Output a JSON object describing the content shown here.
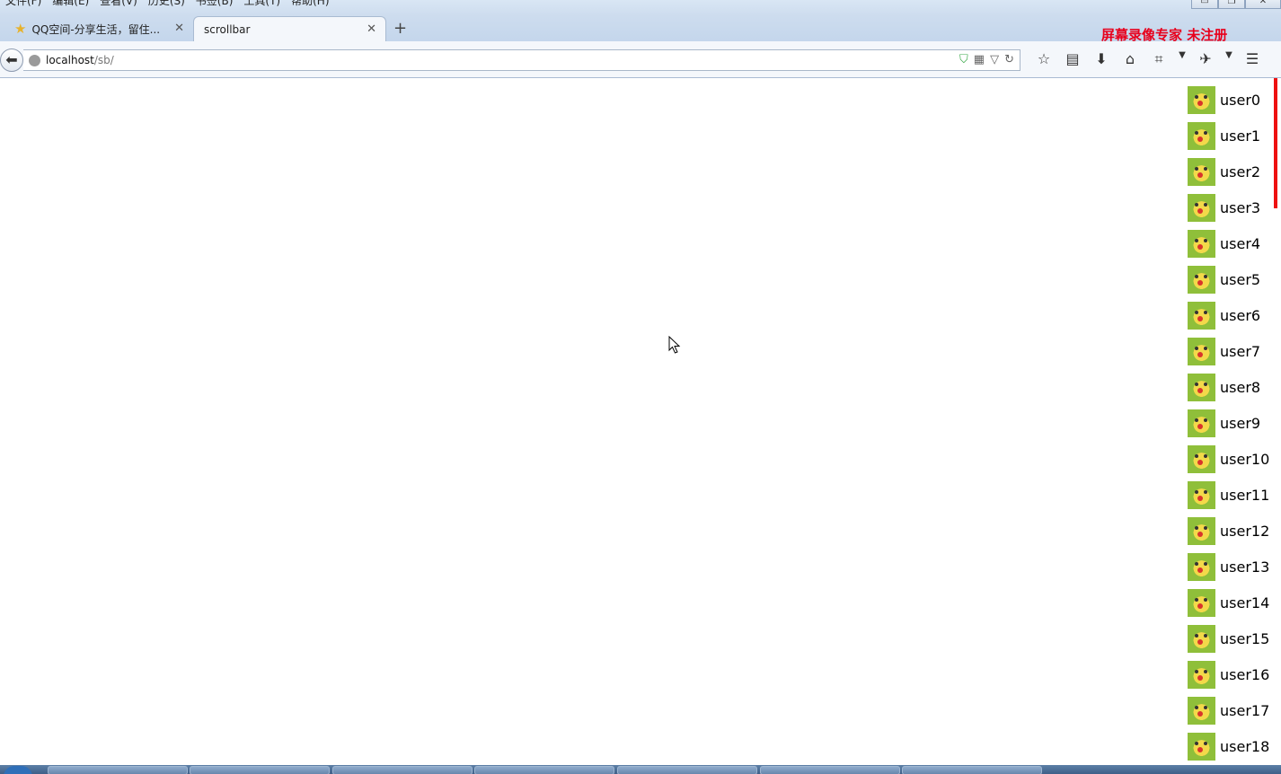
{
  "menu": {
    "items": [
      "文件(F)",
      "编辑(E)",
      "查看(V)",
      "历史(S)",
      "书签(B)",
      "工具(T)",
      "帮助(H)"
    ]
  },
  "window_controls": {
    "minimize": "▭",
    "restore": "❐",
    "close": "✕"
  },
  "tabs": [
    {
      "label": "QQ空间-分享生活，留住...",
      "icon": "star-icon"
    },
    {
      "label": "scrollbar"
    }
  ],
  "watermark": "屏幕录像专家  未注册",
  "address": {
    "host": "localhost",
    "path": "/sb/"
  },
  "users": [
    "user0",
    "user1",
    "user2",
    "user3",
    "user4",
    "user5",
    "user6",
    "user7",
    "user8",
    "user9",
    "user10",
    "user11",
    "user12",
    "user13",
    "user14",
    "user15",
    "user16",
    "user17",
    "user18"
  ],
  "colors": {
    "scroll_thumb": "#ee1111",
    "watermark": "#e8001c"
  }
}
